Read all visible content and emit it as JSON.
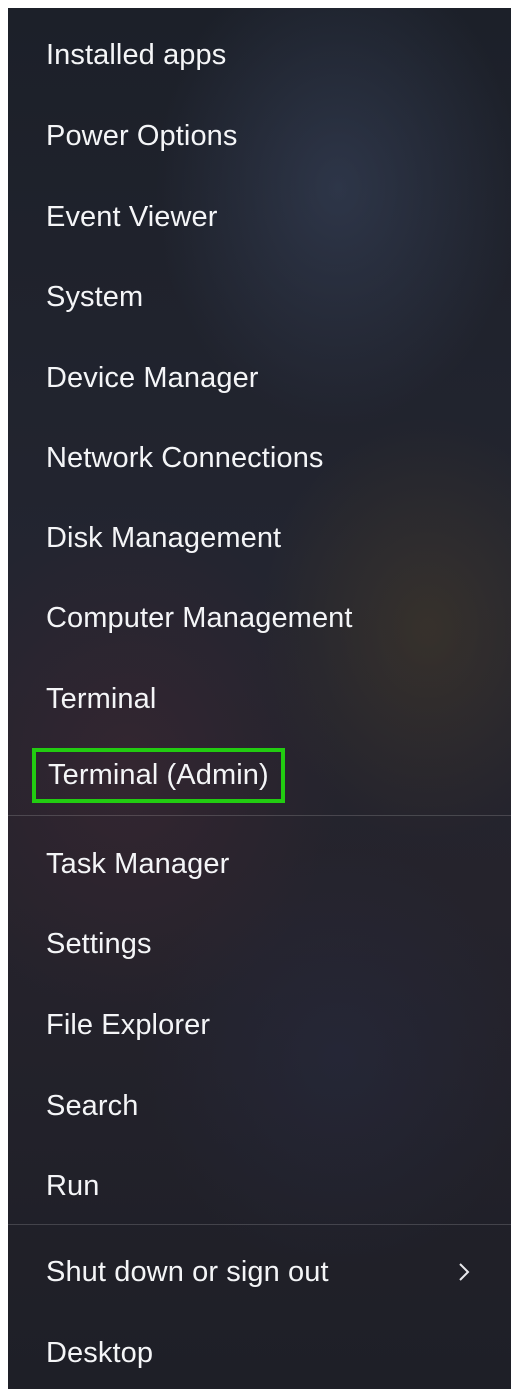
{
  "menu": {
    "group1": [
      "Installed apps",
      "Power Options",
      "Event Viewer",
      "System",
      "Device Manager",
      "Network Connections",
      "Disk Management",
      "Computer Management",
      "Terminal",
      "Terminal (Admin)"
    ],
    "group2": [
      "Task Manager",
      "Settings",
      "File Explorer",
      "Search",
      "Run"
    ],
    "group3": [
      "Shut down or sign out",
      "Desktop"
    ],
    "highlighted_item": "Terminal (Admin)",
    "highlight_color": "#22cc11",
    "submenu_icon": "chevron-right-icon"
  }
}
